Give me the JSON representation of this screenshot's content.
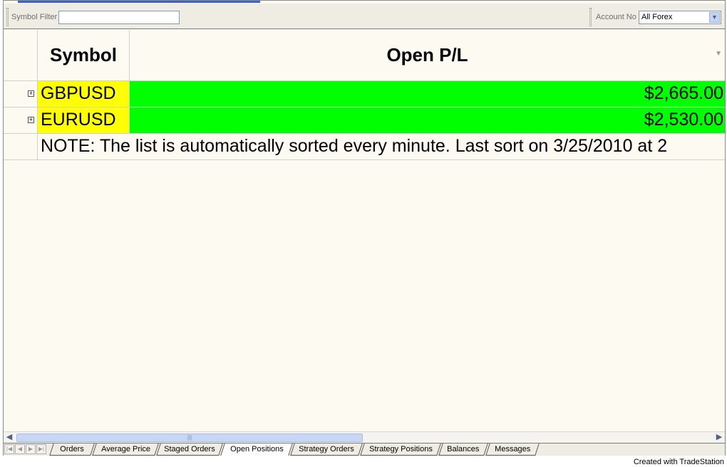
{
  "toolbar": {
    "symbol_filter_label": "Symbol Filter",
    "symbol_filter_value": "",
    "account_label": "Account No",
    "account_value": "All Forex"
  },
  "grid": {
    "headers": {
      "symbol": "Symbol",
      "open_pl": "Open P/L"
    },
    "rows": [
      {
        "symbol": "GBPUSD",
        "open_pl": "$2,665.00",
        "symbol_color": "#ffff00",
        "pl_color": "#00ff00"
      },
      {
        "symbol": "EURUSD",
        "open_pl": "$2,530.00",
        "symbol_color": "#ffff00",
        "pl_color": "#00ff00"
      }
    ],
    "note": "NOTE: The list is automatically sorted every minute. Last sort on 3/25/2010 at 2"
  },
  "tabs": [
    {
      "label": "Orders",
      "active": false
    },
    {
      "label": "Average Price",
      "active": false
    },
    {
      "label": "Staged Orders",
      "active": false
    },
    {
      "label": "Open Positions",
      "active": true
    },
    {
      "label": "Strategy Orders",
      "active": false
    },
    {
      "label": "Strategy Positions",
      "active": false
    },
    {
      "label": "Balances",
      "active": false
    },
    {
      "label": "Messages",
      "active": false
    }
  ],
  "footer": {
    "credit": "Created with TradeStation"
  }
}
